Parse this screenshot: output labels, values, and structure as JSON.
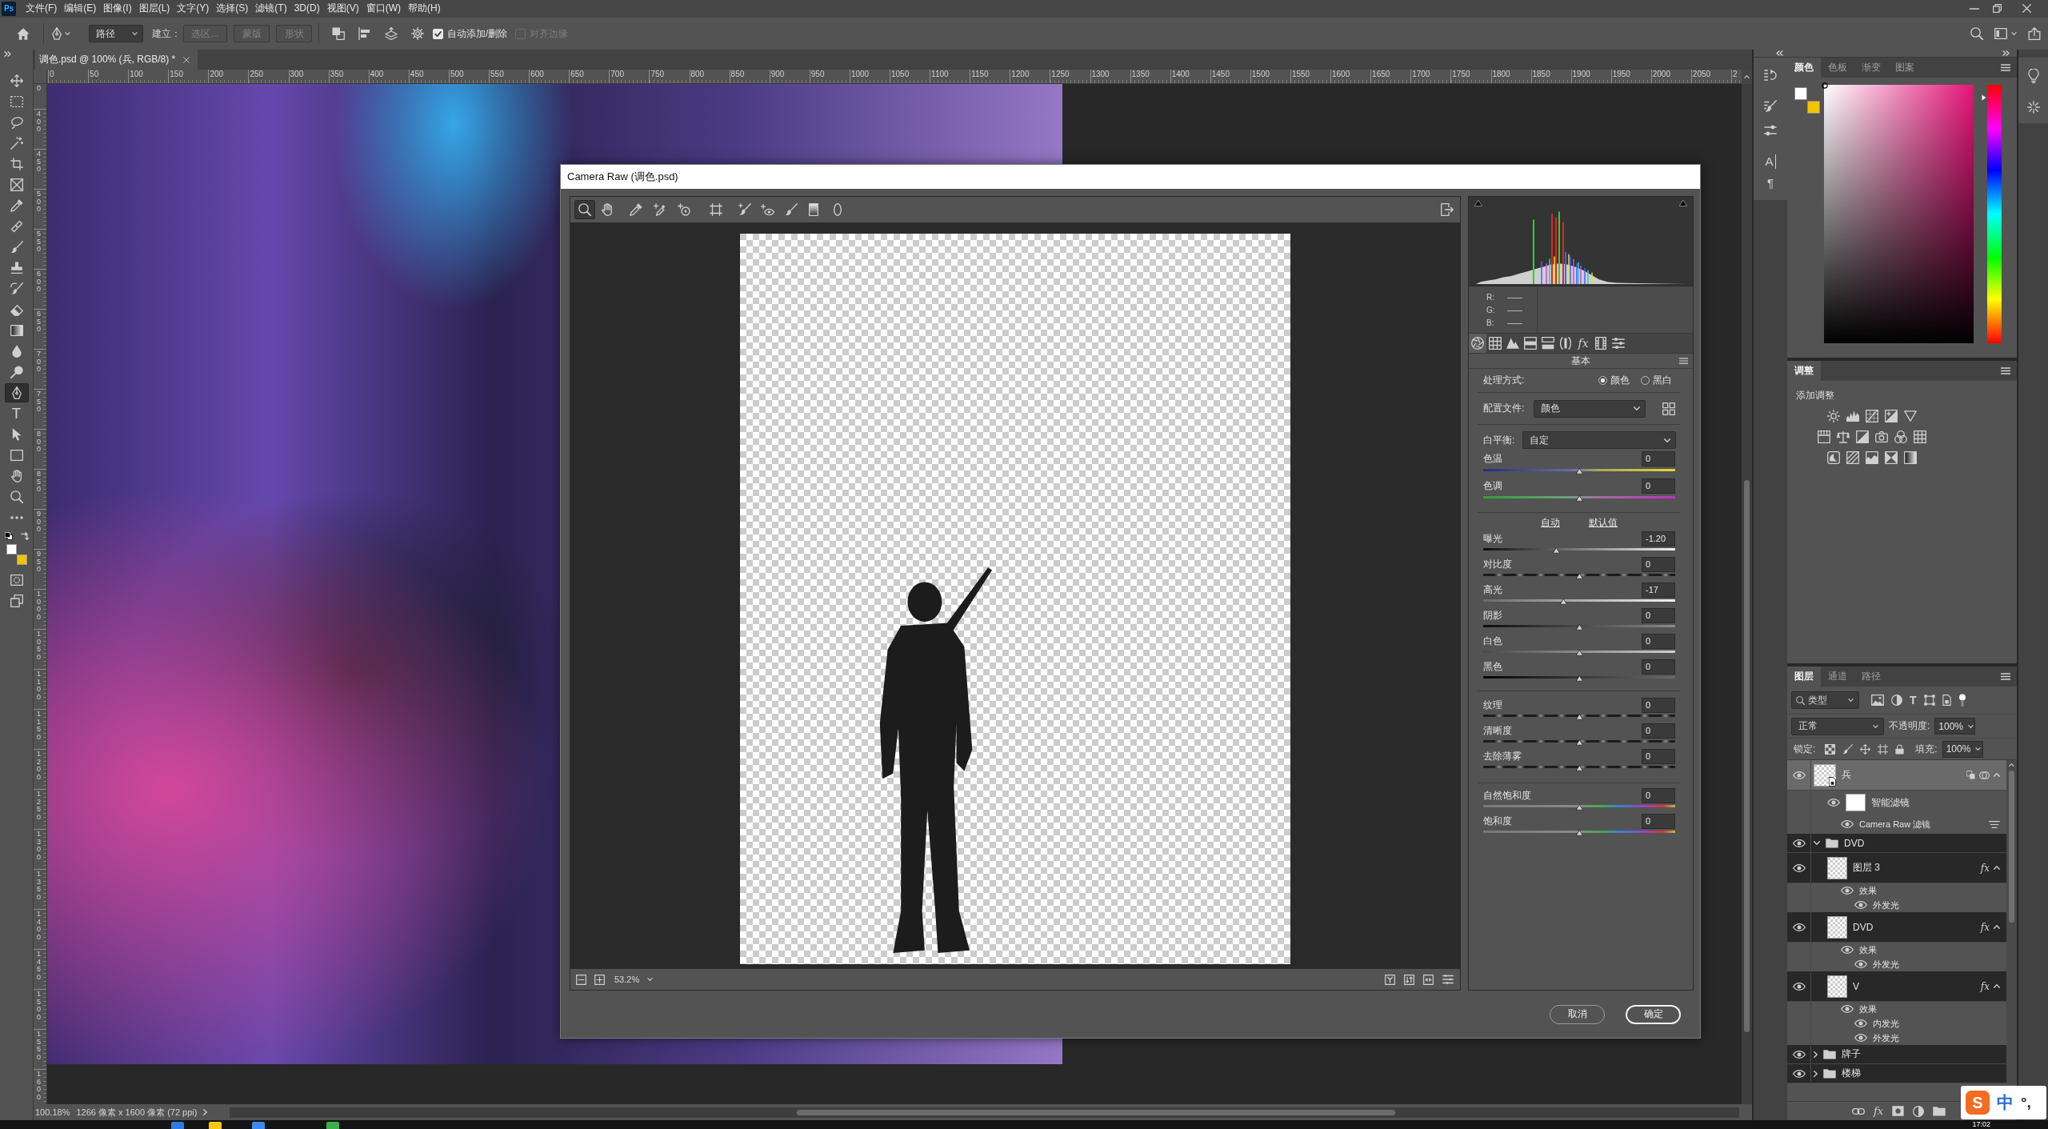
{
  "app": {
    "logo": "Ps"
  },
  "menu_bar": {
    "items": [
      "文件(F)",
      "编辑(E)",
      "图像(I)",
      "图层(L)",
      "文字(Y)",
      "选择(S)",
      "滤镜(T)",
      "3D(D)",
      "视图(V)",
      "窗口(W)",
      "帮助(H)"
    ]
  },
  "options_bar": {
    "path_mode": "路径",
    "make_label": "建立：",
    "make_buttons": [
      {
        "label": "选区...",
        "disabled": true
      },
      {
        "label": "蒙版",
        "disabled": true
      },
      {
        "label": "形状",
        "disabled": true
      }
    ],
    "checkboxes": [
      {
        "label": "自动添加/删除",
        "checked": true,
        "disabled": false
      },
      {
        "label": "对齐边缘",
        "checked": false,
        "disabled": true
      }
    ]
  },
  "toolbox": {
    "tools": [
      {
        "kind": "move",
        "selected": false
      },
      {
        "kind": "marquee",
        "selected": false
      },
      {
        "kind": "lasso",
        "selected": false
      },
      {
        "kind": "wand",
        "selected": false
      },
      {
        "kind": "crop",
        "selected": false
      },
      {
        "kind": "frame",
        "selected": false
      },
      {
        "kind": "eyedropper",
        "selected": false
      },
      {
        "kind": "healing",
        "selected": false
      },
      {
        "kind": "brush",
        "selected": false
      },
      {
        "kind": "stamp",
        "selected": false
      },
      {
        "kind": "history",
        "selected": false
      },
      {
        "kind": "eraser",
        "selected": false
      },
      {
        "kind": "gradient",
        "selected": false
      },
      {
        "kind": "blur",
        "selected": false
      },
      {
        "kind": "dodge",
        "selected": false
      },
      {
        "kind": "pen",
        "selected": true
      },
      {
        "kind": "type",
        "label": "T",
        "selected": false
      },
      {
        "kind": "path",
        "selected": false
      },
      {
        "kind": "rectangle",
        "selected": false
      },
      {
        "kind": "hand",
        "selected": false
      },
      {
        "kind": "zoom",
        "selected": false
      },
      {
        "kind": "more",
        "selected": false
      }
    ],
    "swatches": [
      {
        "color": "#ffffff"
      },
      {
        "color": "#f2c400"
      }
    ]
  },
  "document_tabs": [
    {
      "label": "调色.psd @ 100% (兵, RGB/8) *",
      "selected": true
    }
  ],
  "rulers": {
    "horizontal": [
      "0",
      "50",
      "100",
      "150",
      "200",
      "250",
      "300",
      "350",
      "400",
      "450",
      "500",
      "550",
      "600",
      "650",
      "700",
      "750",
      "800",
      "850",
      "900",
      "950",
      "1000",
      "1050",
      "1100",
      "1150",
      "1200",
      "1250",
      "1300",
      "1350",
      "1400",
      "1450",
      "1500",
      "1550",
      "1600",
      "1650",
      "1700",
      "1750",
      "1800",
      "1850",
      "1900",
      "1950",
      "2000",
      "2050",
      "2"
    ],
    "vertical": [
      "0",
      "400",
      "450",
      "500",
      "550",
      "600",
      "650",
      "700",
      "750",
      "800",
      "850",
      "900",
      "950",
      "1000",
      "1050",
      "1100",
      "1150",
      "1200",
      "1250",
      "1300",
      "1350",
      "1400",
      "1450",
      "1500",
      "1550",
      "1600"
    ]
  },
  "status_bar": {
    "zoom": "100.18%",
    "document_size": "1266 像素 x 1600 像素 (72 ppi)"
  },
  "camera_raw": {
    "title": "Camera Raw (调色.psd)",
    "tools": [
      {
        "kind": "zoom",
        "selected": true
      },
      {
        "kind": "hand",
        "selected": false
      },
      {
        "kind": "eyedropper",
        "selected": false
      },
      {
        "kind": "sampler",
        "selected": false
      },
      {
        "kind": "target",
        "selected": false
      },
      {
        "kind": "transform",
        "selected": false
      },
      {
        "kind": "spot",
        "selected": false
      },
      {
        "kind": "redeye",
        "selected": false
      },
      {
        "kind": "brush",
        "selected": false
      },
      {
        "kind": "graduated",
        "selected": false
      },
      {
        "kind": "radial",
        "selected": false
      }
    ],
    "zoom_level": "53.2%",
    "histogram": {
      "readouts": [
        {
          "label": "R:",
          "value": "——"
        },
        {
          "label": "G:",
          "value": "——"
        },
        {
          "label": "B:",
          "value": "——"
        }
      ]
    },
    "tabs": [
      {
        "kind": "basic",
        "selected": true
      },
      {
        "kind": "curve",
        "selected": false
      },
      {
        "kind": "detail",
        "selected": false
      },
      {
        "kind": "hsl",
        "selected": false
      },
      {
        "kind": "split",
        "selected": false
      },
      {
        "kind": "lens",
        "selected": false
      },
      {
        "kind": "effects",
        "label": "fx",
        "selected": false
      },
      {
        "kind": "calibration",
        "selected": false
      },
      {
        "kind": "presets",
        "selected": false
      }
    ],
    "panel_title": "基本",
    "treatment": {
      "label": "处理方式:",
      "options": [
        {
          "label": "颜色",
          "selected": true
        },
        {
          "label": "黑白",
          "selected": false
        }
      ]
    },
    "profile": {
      "label": "配置文件:",
      "value": "颜色"
    },
    "white_balance": {
      "label": "白平衡:",
      "value": "自定",
      "sliders": [
        {
          "label": "色温",
          "value": "0",
          "level": 0.5,
          "kind": "temperature"
        },
        {
          "label": "色调",
          "value": "0",
          "level": 0.5,
          "kind": "tint"
        }
      ]
    },
    "tone": {
      "links": [
        "自动",
        "默认值"
      ],
      "sliders": [
        {
          "label": "曝光",
          "value": "-1.20",
          "level": 0.38,
          "kind": "exposure"
        },
        {
          "label": "对比度",
          "value": "0",
          "level": 0.5,
          "kind": "contrast"
        },
        {
          "label": "高光",
          "value": "-17",
          "level": 0.417,
          "kind": "highlights"
        },
        {
          "label": "阴影",
          "value": "0",
          "level": 0.5,
          "kind": "shadows"
        },
        {
          "label": "白色",
          "value": "0",
          "level": 0.5,
          "kind": "whites"
        },
        {
          "label": "黑色",
          "value": "0",
          "level": 0.5,
          "kind": "blacks"
        }
      ]
    },
    "presence": {
      "sliders": [
        {
          "label": "纹理",
          "value": "0",
          "level": 0.5,
          "kind": "texture"
        },
        {
          "label": "清晰度",
          "value": "0",
          "level": 0.5,
          "kind": "texture"
        },
        {
          "label": "去除薄雾",
          "value": "0",
          "level": 0.5,
          "kind": "texture"
        }
      ]
    },
    "color": {
      "sliders": [
        {
          "label": "自然饱和度",
          "value": "0",
          "level": 0.5,
          "kind": "vibrance"
        },
        {
          "label": "饱和度",
          "value": "0",
          "level": 0.5,
          "kind": "vibrance"
        }
      ]
    },
    "buttons": [
      {
        "label": "取消",
        "primary": false
      },
      {
        "label": "确定",
        "primary": true
      }
    ]
  },
  "panel_dock": {
    "character_label": "A",
    "paragraph_label": "¶"
  },
  "color_panel": {
    "tabs": [
      {
        "label": "颜色",
        "selected": true
      },
      {
        "label": "色板",
        "selected": false
      },
      {
        "label": "渐变",
        "selected": false
      },
      {
        "label": "图案",
        "selected": false
      }
    ],
    "swatches": [
      {
        "color": "#ffffff"
      },
      {
        "color": "#f2c400"
      }
    ],
    "hue_slider": {
      "level": 0.95
    }
  },
  "adjustments_panel": {
    "tabs": [
      {
        "label": "调整",
        "selected": true
      }
    ],
    "title": "添加调整"
  },
  "layers_panel": {
    "tabs": [
      {
        "label": "图层",
        "selected": true
      },
      {
        "label": "通道",
        "selected": false
      },
      {
        "label": "路径",
        "selected": false
      }
    ],
    "filter": {
      "value": "类型",
      "type_label": "T"
    },
    "blend_mode": "正常",
    "opacity_label": "不透明度:",
    "opacity": "100%",
    "lock_label": "锁定:",
    "fill_label": "填充:",
    "fill": "100%",
    "layers": [
      {
        "kind": "smart",
        "name": "兵",
        "visible": true,
        "selected": true,
        "expanded": true,
        "children": [
          {
            "kind": "filters",
            "name": "智能滤镜",
            "visible": true,
            "children": [
              {
                "kind": "filter",
                "name": "Camera Raw 滤镜",
                "visible": true
              }
            ]
          }
        ]
      },
      {
        "kind": "group",
        "name": "DVD",
        "visible": true,
        "selected": false,
        "expanded": true,
        "children": [
          {
            "kind": "layer",
            "name": "图层 3",
            "visible": true,
            "selected": false,
            "expanded": true,
            "badge": "fx",
            "children": [
              {
                "kind": "effects",
                "name": "效果",
                "visible": true,
                "children": [
                  {
                    "kind": "effect",
                    "name": "外发光",
                    "visible": true
                  }
                ]
              }
            ]
          },
          {
            "kind": "layer",
            "name": "DVD",
            "visible": true,
            "selected": false,
            "expanded": true,
            "badge": "fx",
            "children": [
              {
                "kind": "effects",
                "name": "效果",
                "visible": true,
                "children": [
                  {
                    "kind": "effect",
                    "name": "外发光",
                    "visible": true
                  }
                ]
              }
            ]
          },
          {
            "kind": "layer",
            "name": "V",
            "visible": true,
            "selected": false,
            "expanded": true,
            "badge": "fx",
            "children": [
              {
                "kind": "effects",
                "name": "效果",
                "visible": true,
                "children": [
                  {
                    "kind": "effect",
                    "name": "内发光",
                    "visible": true
                  },
                  {
                    "kind": "effect",
                    "name": "外发光",
                    "visible": true
                  }
                ]
              }
            ]
          }
        ]
      },
      {
        "kind": "group",
        "name": "牌子",
        "visible": true,
        "selected": false,
        "expanded": false
      },
      {
        "kind": "group",
        "name": "楼梯",
        "visible": true,
        "selected": false,
        "expanded": false
      }
    ],
    "style_button": "fx"
  },
  "ime_toolbar": {
    "logo": "S",
    "mode": "中",
    "punctuation": "°,"
  },
  "taskbar": {
    "clock": "17:02"
  }
}
